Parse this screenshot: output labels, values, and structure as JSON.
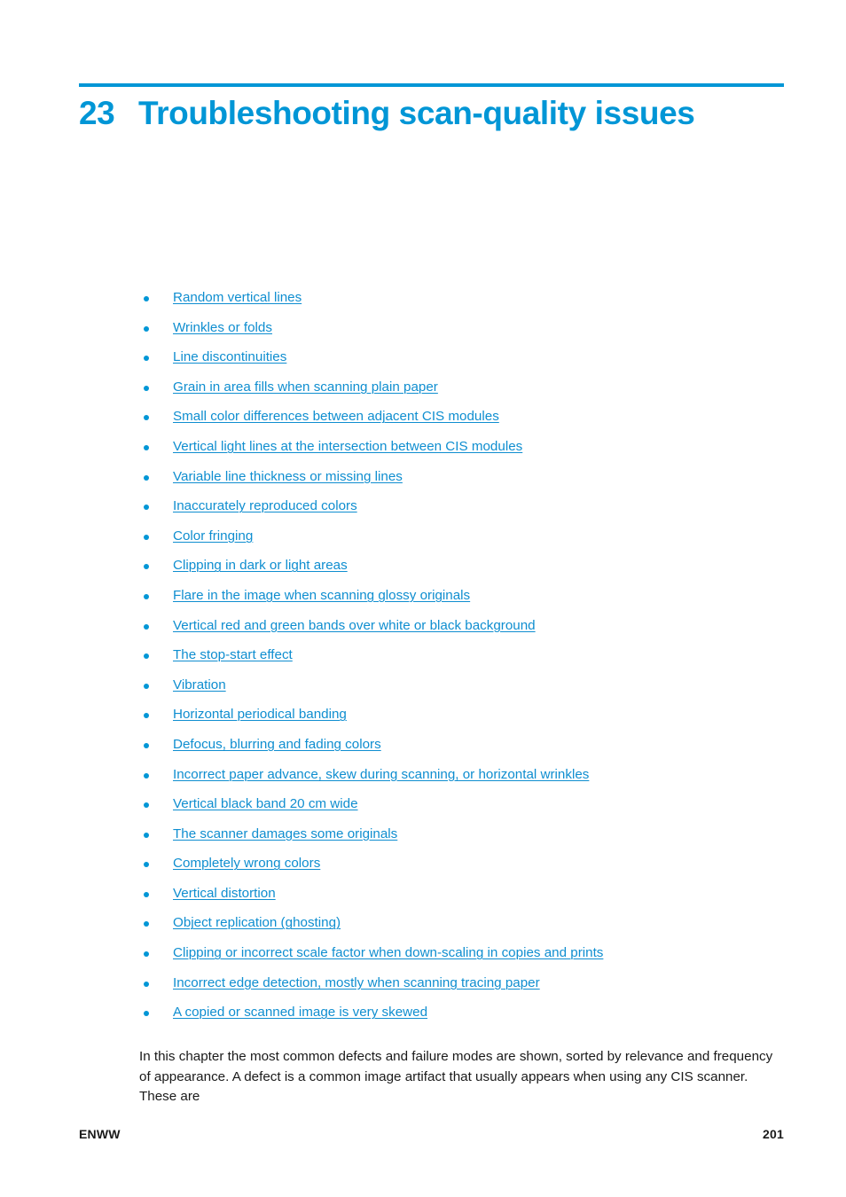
{
  "document": {
    "chapter": {
      "number": "23",
      "title": "Troubleshooting scan-quality issues"
    },
    "accent_color": "#0096d6",
    "link_color": "#0f8ed0",
    "text_color": "#1a1a1a"
  },
  "toc_links": [
    {
      "label": "Random vertical lines"
    },
    {
      "label": "Wrinkles or folds"
    },
    {
      "label": "Line discontinuities"
    },
    {
      "label": "Grain in area fills when scanning plain paper"
    },
    {
      "label": "Small color differences between adjacent CIS modules"
    },
    {
      "label": "Vertical light lines at the intersection between CIS modules"
    },
    {
      "label": "Variable line thickness or missing lines"
    },
    {
      "label": "Inaccurately reproduced colors"
    },
    {
      "label": "Color fringing"
    },
    {
      "label": "Clipping in dark or light areas"
    },
    {
      "label": "Flare in the image when scanning glossy originals"
    },
    {
      "label": "Vertical red and green bands over white or black background"
    },
    {
      "label": "The stop-start effect"
    },
    {
      "label": "Vibration"
    },
    {
      "label": "Horizontal periodical banding"
    },
    {
      "label": "Defocus, blurring and fading colors"
    },
    {
      "label": "Incorrect paper advance, skew during scanning, or horizontal wrinkles"
    },
    {
      "label": "Vertical black band 20 cm wide"
    },
    {
      "label": "The scanner damages some originals"
    },
    {
      "label": "Completely wrong colors"
    },
    {
      "label": "Vertical distortion"
    },
    {
      "label": "Object replication (ghosting)"
    },
    {
      "label": "Clipping or incorrect scale factor when down-scaling in copies and prints"
    },
    {
      "label": "Incorrect edge detection, mostly when scanning tracing paper"
    },
    {
      "label": "A copied or scanned image is very skewed"
    }
  ],
  "intro": {
    "paragraph": "In this chapter the most common defects and failure modes are shown, sorted by relevance and frequency of appearance. A defect is a common image artifact that usually appears when using any CIS scanner. These are"
  },
  "footer": {
    "left": "ENWW",
    "page_number": "201"
  }
}
